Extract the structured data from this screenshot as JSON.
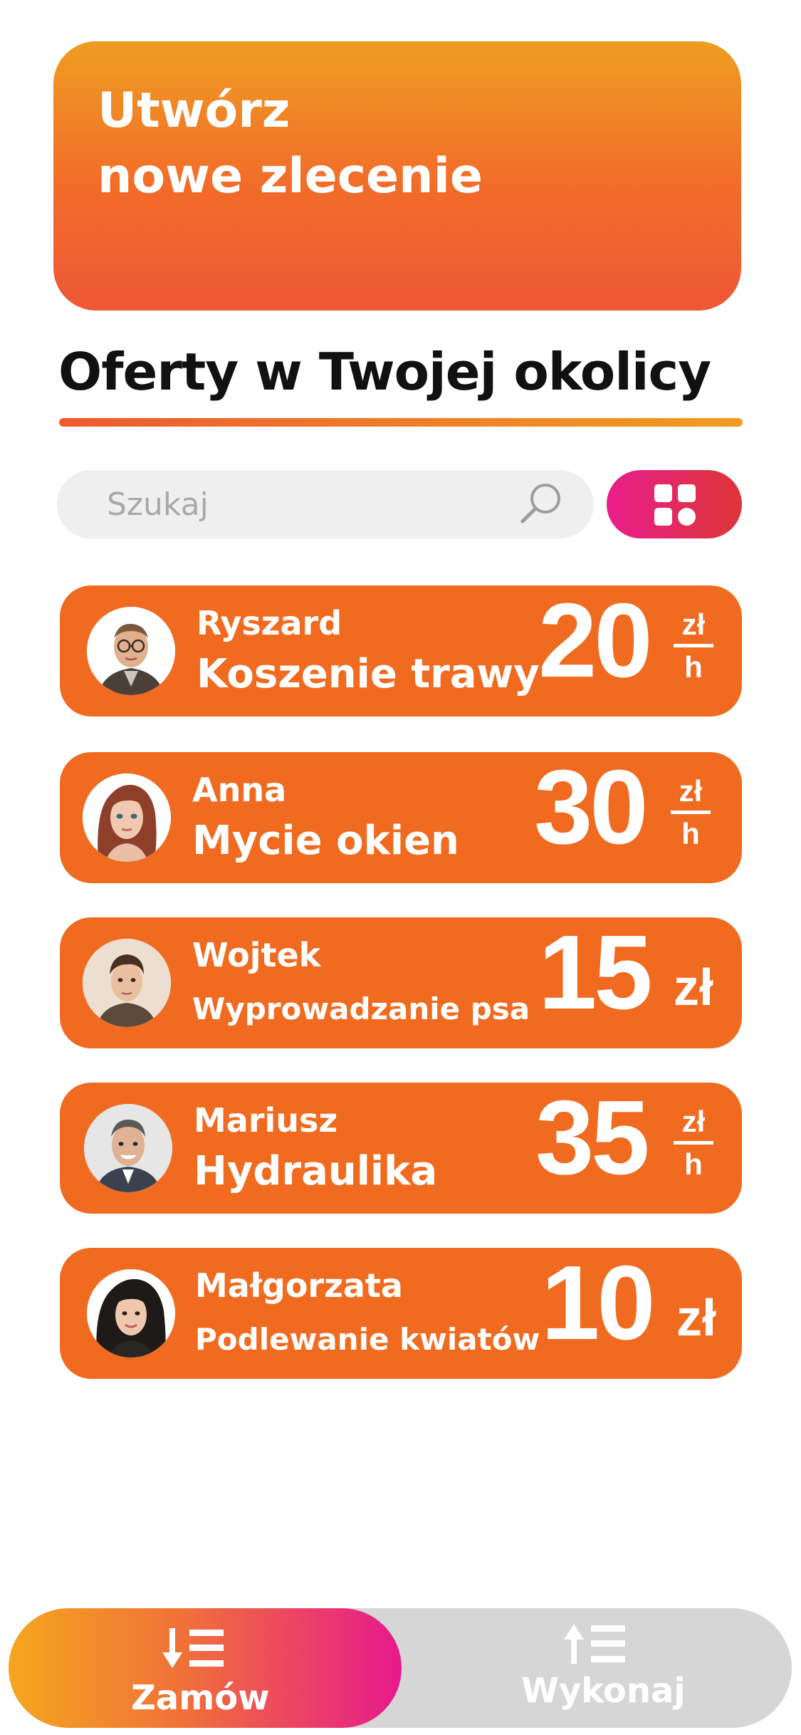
{
  "create_order": {
    "line1": "Utwórz",
    "line2": "nowe zlecenie"
  },
  "section": {
    "title": "Oferty w Twojej okolicy"
  },
  "search": {
    "placeholder": "Szukaj",
    "value": ""
  },
  "colors": {
    "accent_orange": "#f06b20",
    "gradient_start": "#f5a61e",
    "gradient_end": "#e7198c",
    "nav_inactive": "#d6d6d6"
  },
  "offers": [
    {
      "name": "Ryszard",
      "service": "Koszenie trawy",
      "price": "20",
      "unit_top": "zł",
      "unit_bottom": "h",
      "avatar": "man-glasses-avatar"
    },
    {
      "name": "Anna",
      "service": "Mycie okien",
      "price": "30",
      "unit_top": "zł",
      "unit_bottom": "h",
      "avatar": "woman-red-hair-avatar"
    },
    {
      "name": "Wojtek",
      "service": "Wyprowadzanie psa",
      "price": "15",
      "unit": "zł",
      "avatar": "young-man-avatar"
    },
    {
      "name": "Mariusz",
      "service": "Hydraulika",
      "price": "35",
      "unit_top": "zł",
      "unit_bottom": "h",
      "avatar": "man-suit-avatar"
    },
    {
      "name": "Małgorzata",
      "service": "Podlewanie kwiatów",
      "price": "10",
      "unit": "zł",
      "avatar": "woman-dark-hair-avatar"
    }
  ],
  "bottom_nav": {
    "order_label": "Zamów",
    "order_icon": "sort-down-list-icon",
    "execute_label": "Wykonaj",
    "execute_icon": "sort-up-list-icon"
  }
}
